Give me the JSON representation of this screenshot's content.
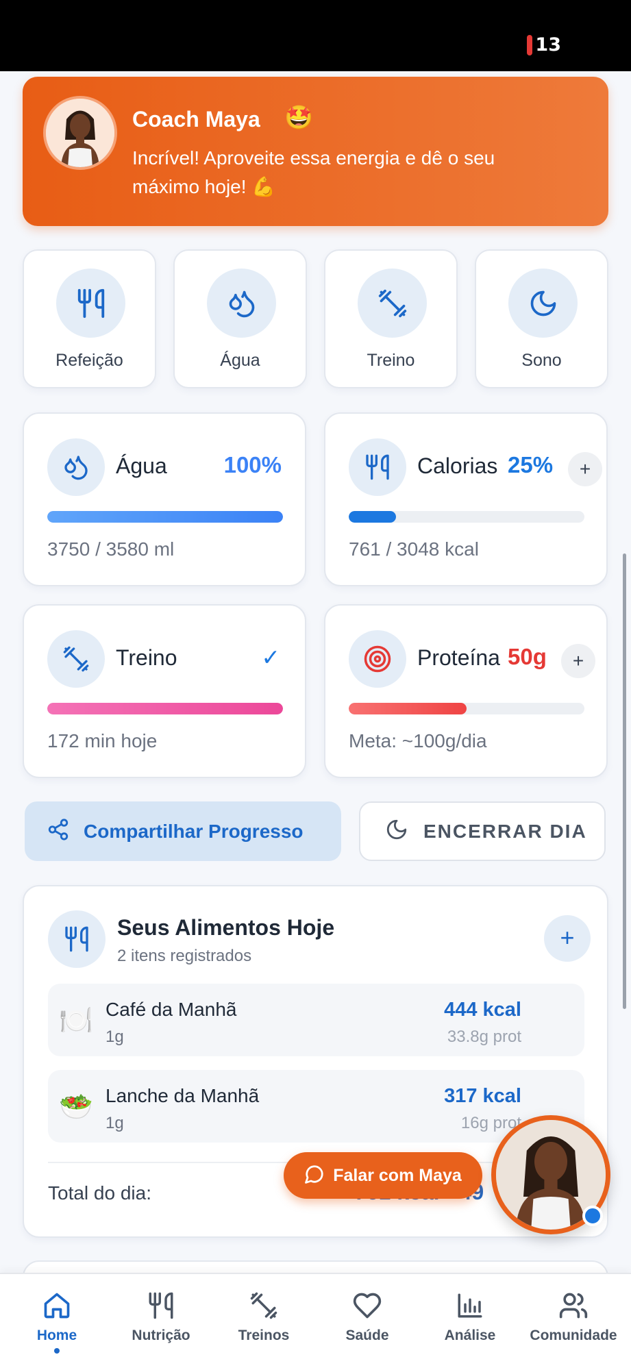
{
  "status_bar": {
    "battery": "13"
  },
  "coach": {
    "name": "Coach Maya",
    "name_emoji": "🤩",
    "message": "Incrível! Aproveite essa energia e dê o seu máximo hoje! 💪"
  },
  "quick_actions": [
    {
      "label": "Refeição",
      "icon": "fork-knife-icon"
    },
    {
      "label": "Água",
      "icon": "water-drops-icon"
    },
    {
      "label": "Treino",
      "icon": "dumbbell-icon"
    },
    {
      "label": "Sono",
      "icon": "moon-icon"
    }
  ],
  "stats": {
    "water": {
      "title": "Água",
      "value": "100%",
      "progress": 1.0,
      "detail": "3750 / 3580 ml",
      "color": "#3b82f6"
    },
    "calories": {
      "title": "Calorias",
      "value": "25%",
      "progress": 0.2,
      "detail": "761 / 3048 kcal",
      "plus": "+",
      "color": "#1c78e0"
    },
    "workout": {
      "title": "Treino",
      "value": "✓",
      "progress": 1.0,
      "detail": "172 min hoje",
      "color": "#ec4899"
    },
    "protein": {
      "title": "Proteína",
      "value": "50g",
      "progress": 0.5,
      "detail": "Meta: ~100g/dia",
      "plus": "+",
      "color": "#ef4444"
    }
  },
  "actions": {
    "share_label": "Compartilhar Progresso",
    "end_day_label": "ENCERRAR DIA"
  },
  "foods": {
    "title": "Seus Alimentos Hoje",
    "count": "2 itens registrados",
    "add": "+",
    "items": [
      {
        "emoji": "🍽️",
        "name": "Café da Manhã",
        "qty": "1g",
        "kcal": "444 kcal",
        "protein": "33.8g prot"
      },
      {
        "emoji": "🥗",
        "name": "Lanche da Manhã",
        "qty": "1g",
        "kcal": "317 kcal",
        "protein": "16g prot"
      }
    ],
    "total_label": "Total do dia:",
    "total_value": "761 kcal • 49"
  },
  "chat": {
    "label": "Falar com Maya"
  },
  "tabbar": {
    "tabs": [
      {
        "label": "Home",
        "icon": "home-icon",
        "active": true
      },
      {
        "label": "Nutrição",
        "icon": "fork-knife-icon"
      },
      {
        "label": "Treinos",
        "icon": "dumbbell-icon"
      },
      {
        "label": "Saúde",
        "icon": "heart-icon"
      },
      {
        "label": "Análise",
        "icon": "bar-chart-icon"
      },
      {
        "label": "Comunidade",
        "icon": "users-icon"
      }
    ]
  },
  "colors": {
    "brand_orange": "#e8611c",
    "brand_blue": "#1c68c8"
  }
}
